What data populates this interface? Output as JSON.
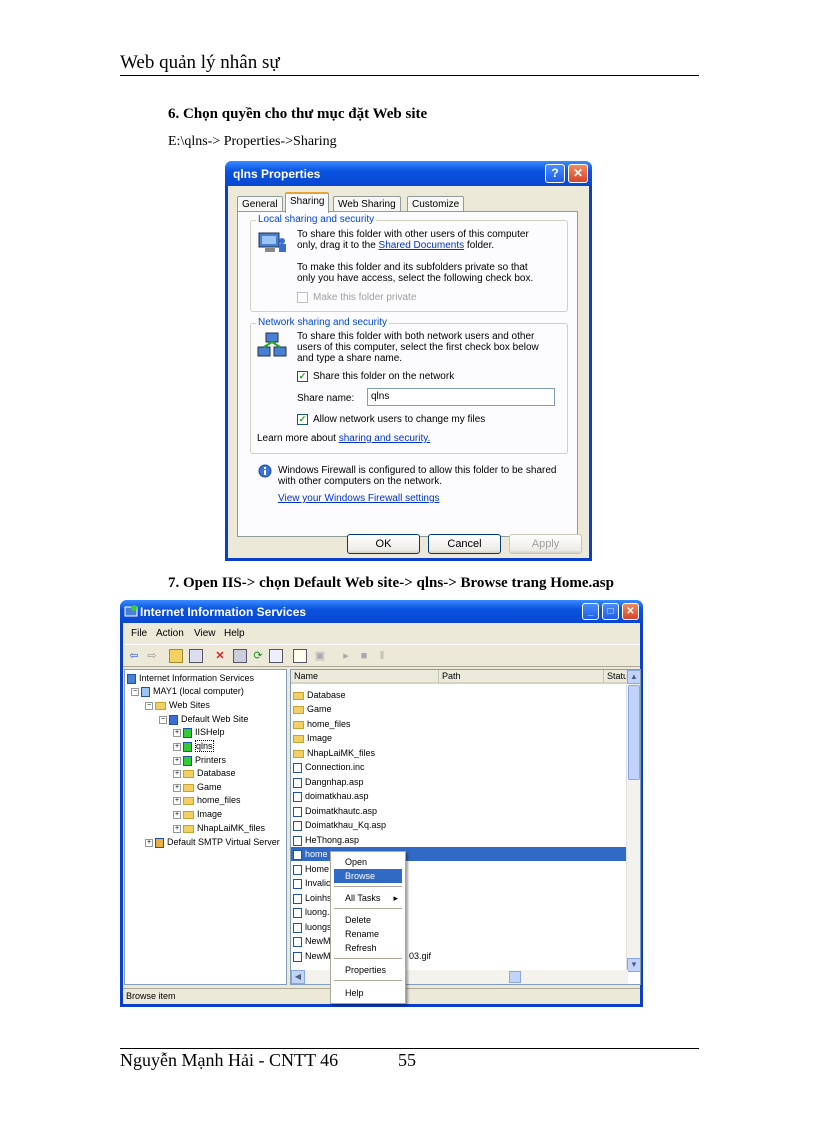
{
  "page": {
    "header_title": "Web quản lý nhân sự",
    "step6": "6. Chọn quyền cho thư mục đặt Web site",
    "step6_path": "E:\\qlns->  Properties->Sharing",
    "step7": "7. Open IIS-> chọn Default Web site-> qlns-> Browse trang Home.asp",
    "footer_author": "Nguyễn Mạnh Hải - CNTT 46",
    "footer_page": "55"
  },
  "dialog": {
    "title": "qlns Properties",
    "help_btn": "?",
    "close_btn": "✕",
    "tabs": [
      "General",
      "Sharing",
      "Web Sharing",
      "Customize"
    ],
    "active_tab": "Sharing",
    "local_group_title": "Local sharing and security",
    "local_text1_a": "To share this folder with other users of this computer",
    "local_text1_b": "only, drag it to the",
    "local_link": "Shared Documents",
    "local_text1_c": "folder.",
    "local_text2_a": "To make this folder and its subfolders private so that",
    "local_text2_b": "only you have access, select the following check box.",
    "make_private": "Make this folder private",
    "network_group_title": "Network sharing and security",
    "net_text_a": "To share this folder with both network users and other",
    "net_text_b": "users of this computer, select the first check box below",
    "net_text_c": "and type a share name.",
    "share_checkbox": "Share this folder on the network",
    "share_name_label": "Share name:",
    "share_name_value": "qlns",
    "allow_checkbox": "Allow network users to change my files",
    "learn_more": "Learn more about",
    "learn_link": "sharing and security.",
    "firewall_a": "Windows Firewall is configured to allow this folder to be shared",
    "firewall_b": "with other computers on the network.",
    "firewall_link": "View your Windows Firewall settings",
    "ok": "OK",
    "cancel": "Cancel",
    "apply": "Apply",
    "check_mark": "✓"
  },
  "iis": {
    "title": "Internet Information Services",
    "menu": [
      "File",
      "Action",
      "View",
      "Help"
    ],
    "tree": [
      {
        "label": "Internet Information Services"
      },
      {
        "label": "MAY1 (local computer)"
      },
      {
        "label": "Web Sites"
      },
      {
        "label": "Default Web Site"
      },
      {
        "label": "IISHelp"
      },
      {
        "label": "qlns"
      },
      {
        "label": "Printers"
      },
      {
        "label": "Database"
      },
      {
        "label": "Game"
      },
      {
        "label": "home_files"
      },
      {
        "label": "Image"
      },
      {
        "label": "NhapLaiMK_files"
      },
      {
        "label": "Default SMTP Virtual Server"
      }
    ],
    "columns": [
      "Name",
      "Path",
      "Statu"
    ],
    "files": [
      "Database",
      "Game",
      "home_files",
      "Image",
      "NhapLaiMK_files",
      "Connection.inc",
      "Dangnhap.asp",
      "doimatkhau.asp",
      "Doimatkhautc.asp",
      "Doimatkhau_Kq.asp",
      "HeThong.asp",
      "home",
      "Home",
      "Invalic",
      "Loinhs",
      "luong.",
      "luongs",
      "NewM",
      "NewM"
    ],
    "file_suffix_gif": "03.gif",
    "context_menu": [
      "Open",
      "Browse",
      "All Tasks",
      "Delete",
      "Rename",
      "Refresh",
      "Properties",
      "Help"
    ],
    "submenu_arrow": "▸",
    "status": "Browse item"
  }
}
